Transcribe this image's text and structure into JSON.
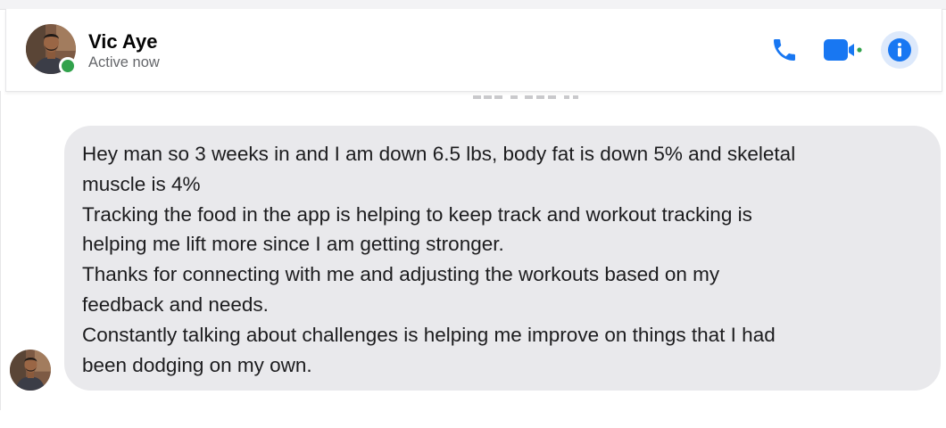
{
  "conversation": {
    "contact_name": "Vic Aye",
    "contact_status": "Active now"
  },
  "header_actions": {
    "phone_icon": "phone-icon",
    "video_icon": "video-camera-icon",
    "info_icon": "info-icon"
  },
  "message": {
    "lines": [
      "Hey man so 3 weeks in and I am down 6.5 lbs, body fat is down 5% and  skeletal",
      "muscle is 4%",
      "Tracking the food in the app is helping to keep track and workout tracking is",
      "helping me lift more since I am getting stronger.",
      "Thanks for connecting with me and adjusting the workouts based on my",
      "feedback and needs.",
      "Constantly talking about challenges is helping me improve on things that I had",
      "been dodging on my own."
    ]
  },
  "colors": {
    "accent_blue": "#1877f2",
    "presence_green": "#31a24c",
    "bubble_gray": "#e9e9ec"
  }
}
